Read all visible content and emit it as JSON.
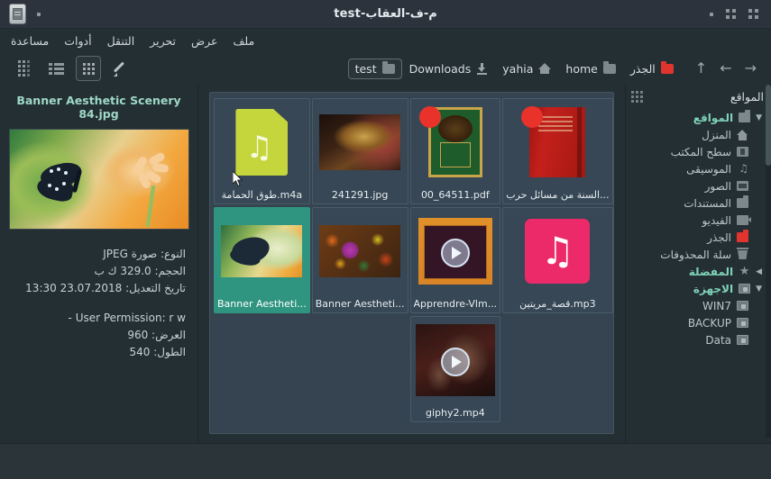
{
  "window": {
    "title": "م-ف-العقاب-test",
    "left_controls": [
      "dot-grid",
      "dot-grid",
      "dot"
    ],
    "right_controls": [
      "dot",
      "window-icon"
    ]
  },
  "menubar": {
    "items": [
      {
        "label": "ملف",
        "name": "menu-file"
      },
      {
        "label": "عرض",
        "name": "menu-view"
      },
      {
        "label": "تحرير",
        "name": "menu-edit"
      },
      {
        "label": "التنقل",
        "name": "menu-navigation"
      },
      {
        "label": "أدوات",
        "name": "menu-tools"
      },
      {
        "label": "مساعدة",
        "name": "menu-help"
      }
    ]
  },
  "toolbar": {
    "view_buttons": [
      {
        "name": "view-columns-button",
        "icon": "columns-icon",
        "active": false
      },
      {
        "name": "view-list-button",
        "icon": "list-icon",
        "active": false
      },
      {
        "name": "view-icons-button",
        "icon": "grid-icon",
        "active": true
      }
    ],
    "edit_path_button": {
      "name": "edit-path-button",
      "icon": "pencil-icon"
    },
    "nav_buttons": [
      {
        "name": "nav-up-button",
        "icon": "arrow-up-icon",
        "glyph": "↑"
      },
      {
        "name": "nav-back-button",
        "icon": "arrow-left-icon",
        "glyph": "←"
      },
      {
        "name": "nav-forward-button",
        "icon": "arrow-right-icon",
        "glyph": "→"
      }
    ]
  },
  "breadcrumb": {
    "items": [
      {
        "label": "test",
        "icon": "folder-icon",
        "current": true
      },
      {
        "label": "Downloads",
        "icon": "download-icon",
        "current": false
      },
      {
        "label": "yahia",
        "icon": "home-icon",
        "current": false
      },
      {
        "label": "home",
        "icon": "folder-icon",
        "current": false
      },
      {
        "label": "الجذر",
        "icon": "folder-red-icon",
        "current": false
      }
    ]
  },
  "preview": {
    "filename": "Banner Aesthetic Scenery 84.jpg",
    "image_alt": "butterfly-on-flower-photo",
    "meta": [
      "النوع: صورة JPEG",
      "الحجم: 329.0 ك ب",
      "تاريخ التعديل: 23.07.2018 13:30"
    ],
    "meta2": [
      "User Permission: r  w  -",
      "العرض: 960",
      "الطول: 540"
    ]
  },
  "files": [
    {
      "label": "طوق الحمامة.m4a",
      "kind": "audio-m4a",
      "selected": false
    },
    {
      "label": "241291.jpg",
      "kind": "image-leopard",
      "selected": false
    },
    {
      "label": "00_64511.pdf",
      "kind": "pdf-green-book",
      "selected": false
    },
    {
      "label": "السنة من مسائل حرب...",
      "kind": "pdf-red-book",
      "selected": false
    },
    {
      "label": "Banner Aestheti...",
      "kind": "image-butterfly",
      "selected": true
    },
    {
      "label": "Banner Aestheti...",
      "kind": "image-leaves",
      "selected": false
    },
    {
      "label": "Apprendre-Vlm...",
      "kind": "video-vlc",
      "selected": false
    },
    {
      "label": "قصة_مريتين.mp3",
      "kind": "audio-mp3",
      "selected": false
    },
    {
      "label": "giphy2.mp4",
      "kind": "video-giphy",
      "selected": false
    }
  ],
  "places": {
    "header": "المواقع",
    "items": [
      {
        "label": "المواقع",
        "icon": "folder-icon",
        "group": true,
        "twisty": "▼"
      },
      {
        "label": "المنزل",
        "icon": "home-icon",
        "group": false,
        "twisty": ""
      },
      {
        "label": "سطح المكتب",
        "icon": "desktop-icon",
        "group": false,
        "twisty": ""
      },
      {
        "label": "الموسيقى",
        "icon": "music-icon",
        "group": false,
        "twisty": ""
      },
      {
        "label": "الصور",
        "icon": "pictures-icon",
        "group": false,
        "twisty": ""
      },
      {
        "label": "المستندات",
        "icon": "documents-icon",
        "group": false,
        "twisty": ""
      },
      {
        "label": "الفيديو",
        "icon": "video-icon",
        "group": false,
        "twisty": ""
      },
      {
        "label": "الجذر",
        "icon": "folder-red-icon",
        "group": false,
        "twisty": ""
      },
      {
        "label": "سلة المحذوفات",
        "icon": "trash-icon",
        "group": false,
        "twisty": ""
      },
      {
        "label": "المفضلة",
        "icon": "star-icon",
        "group": true,
        "twisty": "◀"
      },
      {
        "label": "الاجهزة",
        "icon": "disk-icon",
        "group": true,
        "twisty": "▼"
      },
      {
        "label": "WIN7",
        "icon": "disk-icon",
        "group": false,
        "twisty": ""
      },
      {
        "label": "BACKUP",
        "icon": "disk-icon",
        "group": false,
        "twisty": ""
      },
      {
        "label": "Data",
        "icon": "disk-icon",
        "group": false,
        "twisty": ""
      }
    ]
  },
  "colors": {
    "window_bg": "#242f33",
    "titlebar_bg": "#2c333c",
    "filepane_bg": "#354450",
    "tile_bg": "#37475 5",
    "selection": "#2f9480",
    "accent_text": "#7fd2b8",
    "pdf_badge": "#e8322a",
    "mp3_pink": "#ec2a6a",
    "m4a_green": "#c5d53c"
  }
}
